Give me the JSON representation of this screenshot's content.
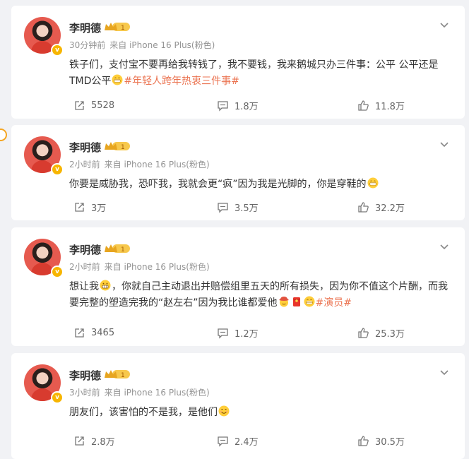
{
  "posts": [
    {
      "author": "李明德",
      "level": "1",
      "time": "30分钟前",
      "source": "来自 iPhone 16 Plus(粉色)",
      "text_main": "铁子们，支付宝不要再给我转钱了，我不要钱，我来鹅城只办三件事：公平 公平还是TMD公平",
      "emoji_1": "grinning-teeth-emoji",
      "hashtag": "#年轻人跨年热衷三件事#",
      "shares": "5528",
      "comments": "1.8万",
      "likes": "11.8万"
    },
    {
      "author": "李明德",
      "level": "1",
      "time": "2小时前",
      "source": "来自 iPhone 16 Plus(粉色)",
      "text_main": "你要是威胁我，恐吓我，我就会更“疯”因为我是光脚的，你是穿鞋的",
      "emoji_1": "grinning-teeth-emoji",
      "shares": "3万",
      "comments": "3.5万",
      "likes": "32.2万"
    },
    {
      "author": "李明德",
      "level": "1",
      "time": "2小时前",
      "source": "来自 iPhone 16 Plus(粉色)",
      "text_main_a": "想让我",
      "emoji_a": "grimace-emoji",
      "text_main_b": "，你就自己主动退出并赔偿组里五天的所有损失，因为你不值这个片酬，而我要完整的塑造完我的“赵左右”因为我比谁都爱他",
      "emoji_b": [
        "cowboy-emoji",
        "red-envelope-emoji",
        "grinning-teeth-emoji"
      ],
      "hashtag": "#演员#",
      "shares": "3465",
      "comments": "1.2万",
      "likes": "25.3万"
    },
    {
      "author": "李明德",
      "level": "1",
      "time": "3小时前",
      "source": "来自 iPhone 16 Plus(粉色)",
      "text_main": "朋友们，该害怕的不是我，是他们",
      "emoji_1": "smile-emoji",
      "shares": "2.8万",
      "comments": "2.4万",
      "likes": "30.5万"
    }
  ],
  "colors": {
    "accent": "#eb7350",
    "badge": "#f7b500",
    "meta": "#939393",
    "background": "#f1f2f5"
  }
}
